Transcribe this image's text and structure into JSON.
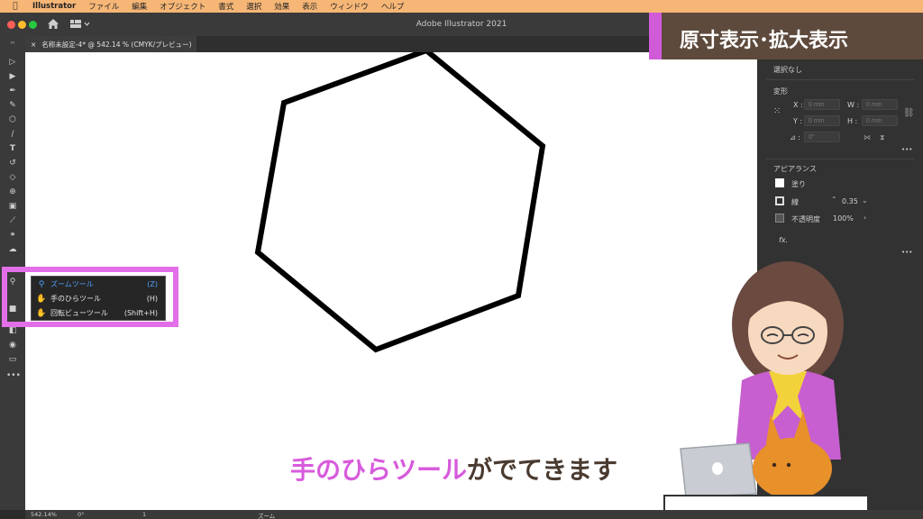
{
  "menubar": {
    "apple_icon": "apple-icon",
    "items": [
      "Illustrator",
      "ファイル",
      "編集",
      "オブジェクト",
      "書式",
      "選択",
      "効果",
      "表示",
      "ウィンドウ",
      "ヘルプ"
    ]
  },
  "window": {
    "title": "Adobe Illustrator 2021"
  },
  "tab": {
    "close": "×",
    "title": "名称未設定-4* @ 542.14 % (CMYK/プレビュー)"
  },
  "heading": "原寸表示･拡大表示",
  "panel": {
    "selection": "選択なし",
    "transform": {
      "title": "変形",
      "x_label": "X :",
      "y_label": "Y :",
      "w_label": "W :",
      "h_label": "H :",
      "x_placeholder": "0 mm",
      "y_placeholder": "0 mm",
      "w_placeholder": "0 mm",
      "h_placeholder": "0 mm",
      "angle_label": "⊿ :",
      "angle_placeholder": "0°"
    },
    "appearance": {
      "title": "アピアランス",
      "fill_label": "塗り",
      "stroke_label": "線",
      "stroke_value": "0.35",
      "opacity_label": "不透明度",
      "opacity_value": "100%",
      "fx_label": "fx."
    },
    "more": "•••"
  },
  "flyout": {
    "items": [
      {
        "label": "ズームツール",
        "shortcut": "(Z)",
        "icon": "magnifier-icon"
      },
      {
        "label": "手のひらツール",
        "shortcut": "(H)",
        "icon": "hand-icon"
      },
      {
        "label": "回転ビューツール",
        "shortcut": "(Shift+H)",
        "icon": "rotate-view-icon"
      }
    ]
  },
  "caption": {
    "highlight": "手のひらツール",
    "rest": "がでてきます"
  },
  "statusbar": {
    "zoom": "542.14%",
    "angle": "0°",
    "artboard": "1",
    "mode": "ズーム"
  },
  "colors": {
    "accent_pink": "#d75bdc",
    "badge_brown": "#5e4a3d",
    "menubar": "#f5b676"
  }
}
